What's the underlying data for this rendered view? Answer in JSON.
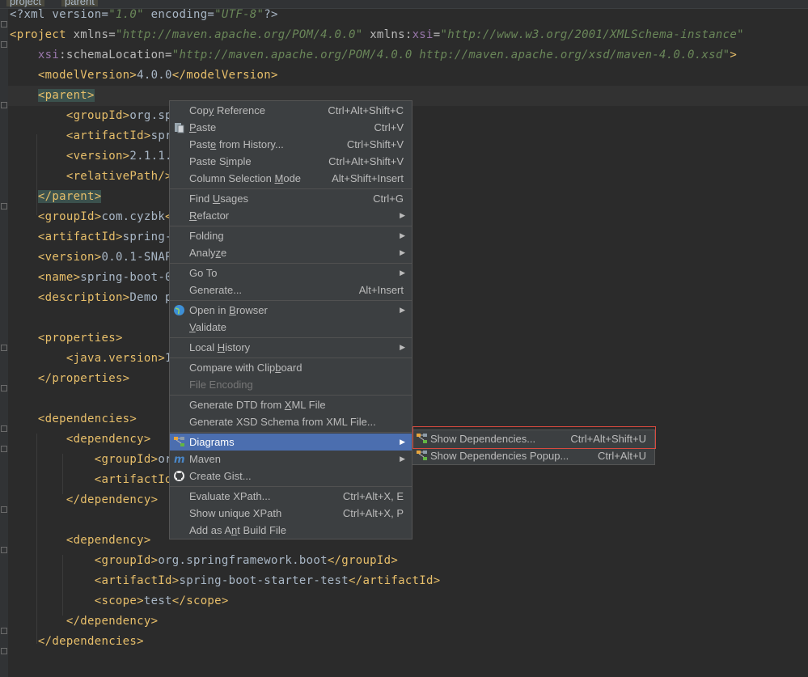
{
  "breadcrumb": {
    "items": [
      "project",
      "parent"
    ]
  },
  "editor": {
    "lines": [
      [
        [
          "tx",
          "<?xml version="
        ],
        [
          "av",
          "\"1.0\""
        ],
        [
          "tx",
          " encoding="
        ],
        [
          "av",
          "\"UTF-8\""
        ],
        [
          "tx",
          "?>"
        ]
      ],
      [
        [
          "t",
          "<project"
        ],
        [
          "an",
          " xmlns="
        ],
        [
          "av",
          "\"http://maven.apache.org/POM/4.0.0\""
        ],
        [
          "an",
          " xmlns:"
        ],
        [
          "ns",
          "xsi"
        ],
        [
          "an",
          "="
        ],
        [
          "av",
          "\"http://www.w3.org/2001/XMLSchema-instance\""
        ]
      ],
      [
        [
          "tx",
          "    "
        ],
        [
          "ns",
          "xsi"
        ],
        [
          "an",
          ":schemaLocation="
        ],
        [
          "av",
          "\"http://maven.apache.org/POM/4.0.0 http://maven.apache.org/xsd/maven-4.0.0.xsd\""
        ],
        [
          "t",
          ">"
        ]
      ],
      [
        [
          "tx",
          "    "
        ],
        [
          "t",
          "<modelVersion>"
        ],
        [
          "tx",
          "4.0.0"
        ],
        [
          "t",
          "</modelVersion>"
        ]
      ],
      [
        [
          "tx",
          "    "
        ],
        [
          "tagbox",
          "<parent>"
        ]
      ],
      [
        [
          "tx",
          "        "
        ],
        [
          "t",
          "<groupId>"
        ],
        [
          "tx",
          "org.spri"
        ]
      ],
      [
        [
          "tx",
          "        "
        ],
        [
          "t",
          "<artifactId>"
        ],
        [
          "tx",
          "sprin"
        ]
      ],
      [
        [
          "tx",
          "        "
        ],
        [
          "t",
          "<version>"
        ],
        [
          "tx",
          "2.1.1.RE"
        ]
      ],
      [
        [
          "tx",
          "        "
        ],
        [
          "t",
          "<relativePath/>"
        ],
        [
          "tx",
          " <"
        ]
      ],
      [
        [
          "tx",
          "    "
        ],
        [
          "tagbox",
          "</parent>"
        ]
      ],
      [
        [
          "tx",
          "    "
        ],
        [
          "t",
          "<groupId>"
        ],
        [
          "tx",
          "com.cyzbk"
        ],
        [
          "t",
          "</g"
        ]
      ],
      [
        [
          "tx",
          "    "
        ],
        [
          "t",
          "<artifactId>"
        ],
        [
          "tx",
          "spring-bo"
        ]
      ],
      [
        [
          "tx",
          "    "
        ],
        [
          "t",
          "<version>"
        ],
        [
          "tx",
          "0.0.1-SNAPSH"
        ]
      ],
      [
        [
          "tx",
          "    "
        ],
        [
          "t",
          "<name>"
        ],
        [
          "tx",
          "spring-boot-05-"
        ]
      ],
      [
        [
          "tx",
          "    "
        ],
        [
          "t",
          "<description>"
        ],
        [
          "tx",
          "Demo pro"
        ]
      ],
      [],
      [
        [
          "tx",
          "    "
        ],
        [
          "t",
          "<properties>"
        ]
      ],
      [
        [
          "tx",
          "        "
        ],
        [
          "t",
          "<java.version>"
        ],
        [
          "tx",
          "1.8"
        ]
      ],
      [
        [
          "tx",
          "    "
        ],
        [
          "t",
          "</properties>"
        ]
      ],
      [],
      [
        [
          "tx",
          "    "
        ],
        [
          "t",
          "<dependencies>"
        ]
      ],
      [
        [
          "tx",
          "        "
        ],
        [
          "t",
          "<dependency>"
        ]
      ],
      [
        [
          "tx",
          "            "
        ],
        [
          "t",
          "<groupId>"
        ],
        [
          "tx",
          "org."
        ]
      ],
      [
        [
          "tx",
          "            "
        ],
        [
          "t",
          "<artifactId>"
        ],
        [
          "tx",
          "s"
        ]
      ],
      [
        [
          "tx",
          "        "
        ],
        [
          "t",
          "</dependency>"
        ]
      ],
      [],
      [
        [
          "tx",
          "        "
        ],
        [
          "t",
          "<dependency>"
        ]
      ],
      [
        [
          "tx",
          "            "
        ],
        [
          "t",
          "<groupId>"
        ],
        [
          "tx",
          "org.springframework.boot"
        ],
        [
          "t",
          "</groupId>"
        ]
      ],
      [
        [
          "tx",
          "            "
        ],
        [
          "t",
          "<artifactId>"
        ],
        [
          "tx",
          "spring-boot-starter-test"
        ],
        [
          "t",
          "</artifactId>"
        ]
      ],
      [
        [
          "tx",
          "            "
        ],
        [
          "t",
          "<scope>"
        ],
        [
          "tx",
          "test"
        ],
        [
          "t",
          "</scope>"
        ]
      ],
      [
        [
          "tx",
          "        "
        ],
        [
          "t",
          "</dependency>"
        ]
      ],
      [
        [
          "tx",
          "    "
        ],
        [
          "t",
          "</dependencies>"
        ]
      ]
    ]
  },
  "context_menu": {
    "items": [
      {
        "pre": "Cop",
        "mn": "y",
        "post": " Reference",
        "shortcut": "Ctrl+Alt+Shift+C"
      },
      {
        "pre": "",
        "mn": "P",
        "post": "aste",
        "shortcut": "Ctrl+V",
        "icon": "paste-icon"
      },
      {
        "pre": "Past",
        "mn": "e",
        "post": " from History...",
        "shortcut": "Ctrl+Shift+V"
      },
      {
        "pre": "Paste S",
        "mn": "i",
        "post": "mple",
        "shortcut": "Ctrl+Alt+Shift+V"
      },
      {
        "pre": "Column Selection ",
        "mn": "M",
        "post": "ode",
        "shortcut": "Alt+Shift+Insert",
        "sep_after": true
      },
      {
        "pre": "Find ",
        "mn": "U",
        "post": "sages",
        "shortcut": "Ctrl+G"
      },
      {
        "pre": "",
        "mn": "R",
        "post": "efactor",
        "submenu": true,
        "sep_after": true
      },
      {
        "pre": "Folding",
        "mn": "",
        "post": "",
        "submenu": true
      },
      {
        "pre": "Analy",
        "mn": "z",
        "post": "e",
        "submenu": true,
        "sep_after": true
      },
      {
        "pre": "Go To",
        "mn": "",
        "post": "",
        "submenu": true
      },
      {
        "pre": "Generate...",
        "mn": "",
        "post": "",
        "shortcut": "Alt+Insert",
        "sep_after": true
      },
      {
        "pre": "Open in ",
        "mn": "B",
        "post": "rowser",
        "submenu": true,
        "icon": "globe-icon"
      },
      {
        "pre": "",
        "mn": "V",
        "post": "alidate",
        "sep_after": true
      },
      {
        "pre": "Local ",
        "mn": "H",
        "post": "istory",
        "submenu": true,
        "sep_after": true
      },
      {
        "pre": "Compare with Clip",
        "mn": "b",
        "post": "oard"
      },
      {
        "pre": "File Encoding",
        "mn": "",
        "post": "",
        "disabled": true,
        "sep_after": true
      },
      {
        "pre": "Generate DTD from ",
        "mn": "X",
        "post": "ML File"
      },
      {
        "pre": "Generate XSD Schema from XML File...",
        "mn": "",
        "post": "",
        "sep_after": true
      },
      {
        "pre": "Diagrams",
        "mn": "",
        "post": "",
        "submenu": true,
        "selected": true,
        "icon": "diagram-icon"
      },
      {
        "pre": "Maven",
        "mn": "",
        "post": "",
        "submenu": true,
        "icon": "maven-icon"
      },
      {
        "pre": "Create Gist...",
        "mn": "",
        "post": "",
        "icon": "github-icon",
        "sep_after": true
      },
      {
        "pre": "Evaluate XPath...",
        "mn": "",
        "post": "",
        "shortcut": "Ctrl+Alt+X, E"
      },
      {
        "pre": "Show unique XPath",
        "mn": "",
        "post": "",
        "shortcut": "Ctrl+Alt+X, P"
      },
      {
        "pre": "Add as A",
        "mn": "n",
        "post": "t Build File"
      }
    ]
  },
  "submenu": {
    "items": [
      {
        "label": "Show Dependencies...",
        "shortcut": "Ctrl+Alt+Shift+U",
        "icon": "diagram-icon"
      },
      {
        "label": "Show Dependencies Popup...",
        "shortcut": "Ctrl+Alt+U",
        "icon": "diagram-icon"
      }
    ]
  },
  "colors": {
    "background": "#2b2b2b",
    "tag": "#e8bf6a",
    "attr_value": "#6a8759",
    "text": "#a9b7c6",
    "namespace": "#9876aa",
    "menu_bg": "#3c3f41",
    "menu_selected": "#4b6eaf",
    "highlight_border": "#d84a3f"
  }
}
